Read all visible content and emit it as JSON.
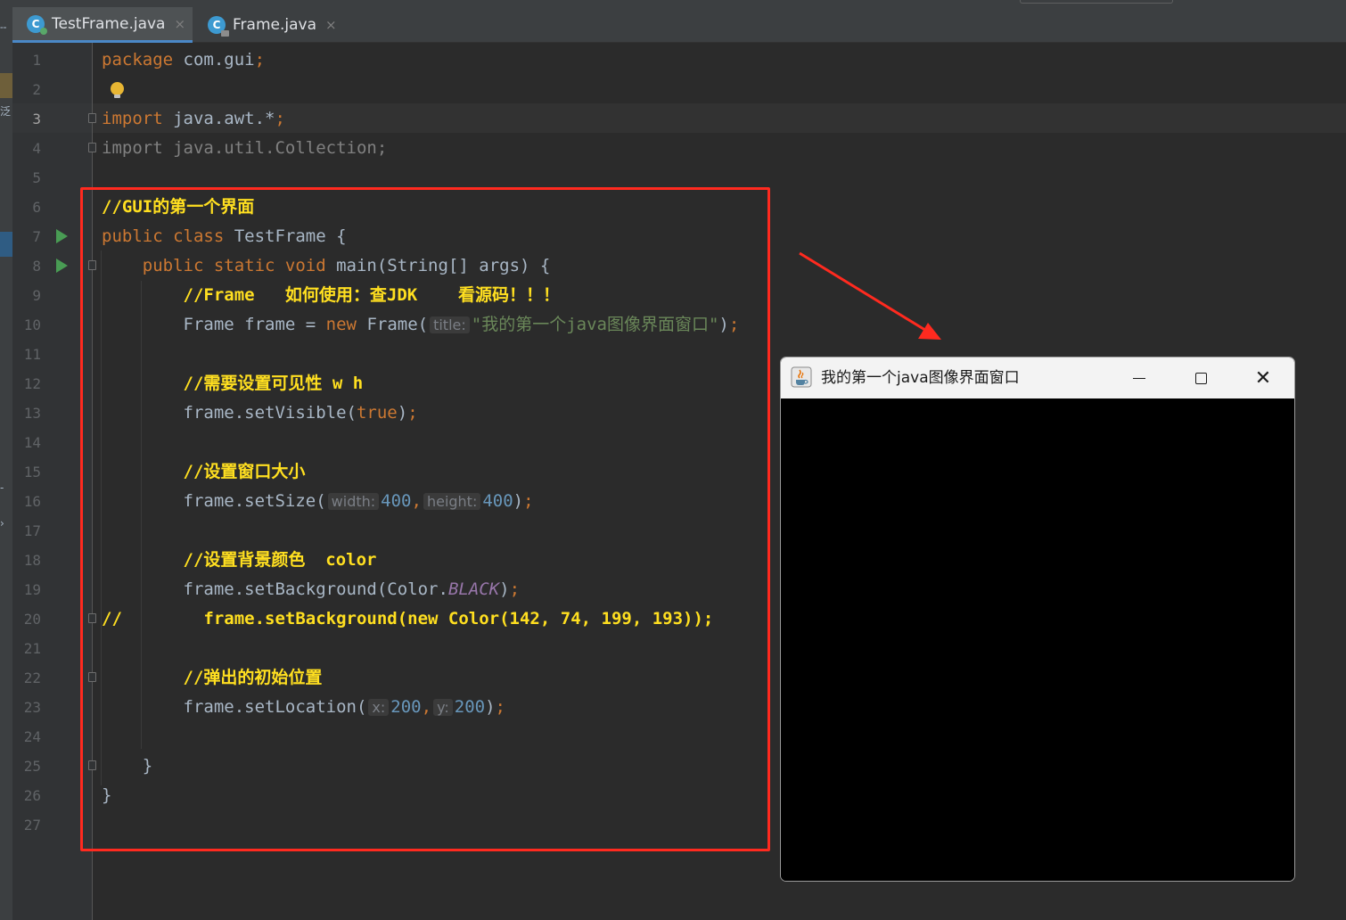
{
  "tabs": [
    {
      "label": "TestFrame.java",
      "icon": "java-class-icon",
      "active": true
    },
    {
      "label": "Frame.java",
      "icon": "java-class-locked-icon",
      "active": false
    }
  ],
  "tab_close_glyph": "×",
  "sidebar_glyphs": {
    "top": "╌",
    "partial_text": "泛",
    "mid": "-",
    "chevron": "›"
  },
  "line_numbers": [
    "1",
    "2",
    "3",
    "4",
    "5",
    "6",
    "7",
    "8",
    "9",
    "10",
    "11",
    "12",
    "13",
    "14",
    "15",
    "16",
    "17",
    "18",
    "19",
    "20",
    "21",
    "22",
    "23",
    "24",
    "25",
    "26",
    "27"
  ],
  "current_line": 3,
  "code": {
    "l1": {
      "kw": "package",
      "rest": " com.gui",
      "semi": ";"
    },
    "l3": {
      "kw": "import",
      "rest": " java.awt.*",
      "semi": ";"
    },
    "l4": {
      "text": "import java.util.Collection;"
    },
    "l6": {
      "comment": "//GUI的第一个界面"
    },
    "l7": {
      "kw": "public class",
      "rest": " TestFrame {"
    },
    "l8": {
      "indent": "    ",
      "kw": "public static void",
      "rest": " main(String[] args) {"
    },
    "l9": {
      "indent": "        ",
      "comment": "//Frame   如何使用：查JDK    看源码！！！"
    },
    "l10": {
      "indent": "        ",
      "pre": "Frame frame = ",
      "kw": "new",
      "post": " Frame(",
      "hint": "title:",
      "str": "\"我的第一个java图像界面窗口\"",
      "end": ")",
      "semi": ";"
    },
    "l12": {
      "indent": "        ",
      "comment": "//需要设置可见性 w h"
    },
    "l13": {
      "indent": "        ",
      "pre": "frame.setVisible(",
      "kw": "true",
      "end": ")",
      "semi": ";"
    },
    "l15": {
      "indent": "        ",
      "comment": "//设置窗口大小"
    },
    "l16": {
      "indent": "        ",
      "pre": "frame.setSize(",
      "hint1": "width:",
      "num1": "400",
      "comma": ",",
      "hint2": "height:",
      "num2": "400",
      "end": ")",
      "semi": ";"
    },
    "l18": {
      "indent": "        ",
      "comment": "//设置背景颜色  color"
    },
    "l19": {
      "indent": "        ",
      "pre": "frame.setBackground(Color.",
      "field": "BLACK",
      "end": ")",
      "semi": ";"
    },
    "l20": {
      "comment": "//        frame.setBackground(new Color(142, 74, 199, 193));"
    },
    "l22": {
      "indent": "        ",
      "comment": "//弹出的初始位置"
    },
    "l23": {
      "indent": "        ",
      "pre": "frame.setLocation(",
      "hint1": "x:",
      "num1": "200",
      "comma": ",",
      "hint2": "y:",
      "num2": "200",
      "end": ")",
      "semi": ";"
    },
    "l25": {
      "text": "    }"
    },
    "l26": {
      "text": "}"
    }
  },
  "java_window": {
    "title": "我的第一个java图像界面窗口",
    "background": "#000000",
    "icon": "java-cup-icon",
    "close_glyph": "✕"
  },
  "colors": {
    "keyword": "#cc7832",
    "comment_highlight": "#ffdf20",
    "string": "#6a8759",
    "number": "#6897bb",
    "static_field": "#9876aa",
    "annotation_red": "#ff2a1f",
    "run_green": "#499c54"
  }
}
